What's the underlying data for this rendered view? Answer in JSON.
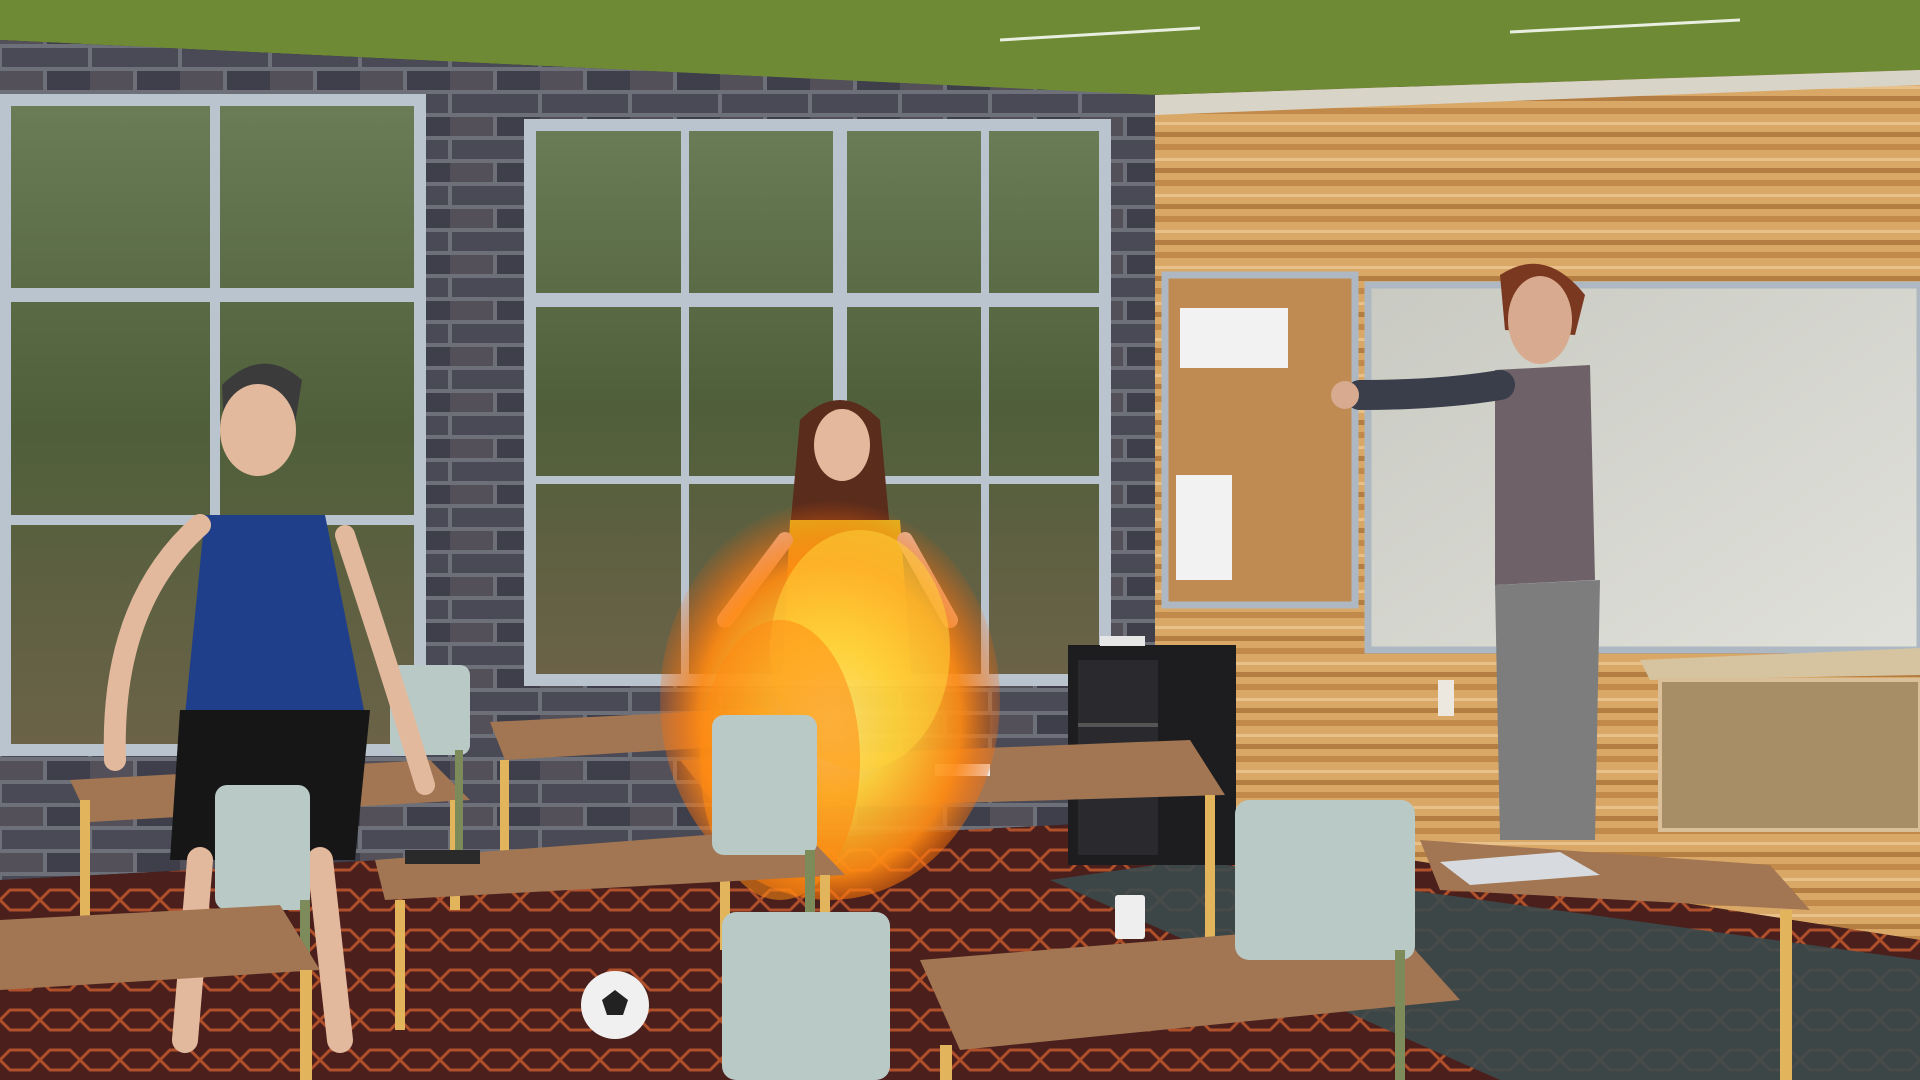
{
  "scene": {
    "title": "",
    "setting": "classroom",
    "colors": {
      "ceiling": "#6f8a35",
      "brick": "#4a4a56",
      "mortar": "#6d7079",
      "window_frame": "#b9c4ce",
      "wood_wall": "#d9a867",
      "corkboard": "#c08b52",
      "whiteboard": "#d7d8d1",
      "desk_top": "#a27652",
      "desk_frame": "#e2b55d",
      "chair": "#b9c9c6",
      "carpet": "#5b2a24",
      "fire": "#ff9a1f"
    }
  }
}
